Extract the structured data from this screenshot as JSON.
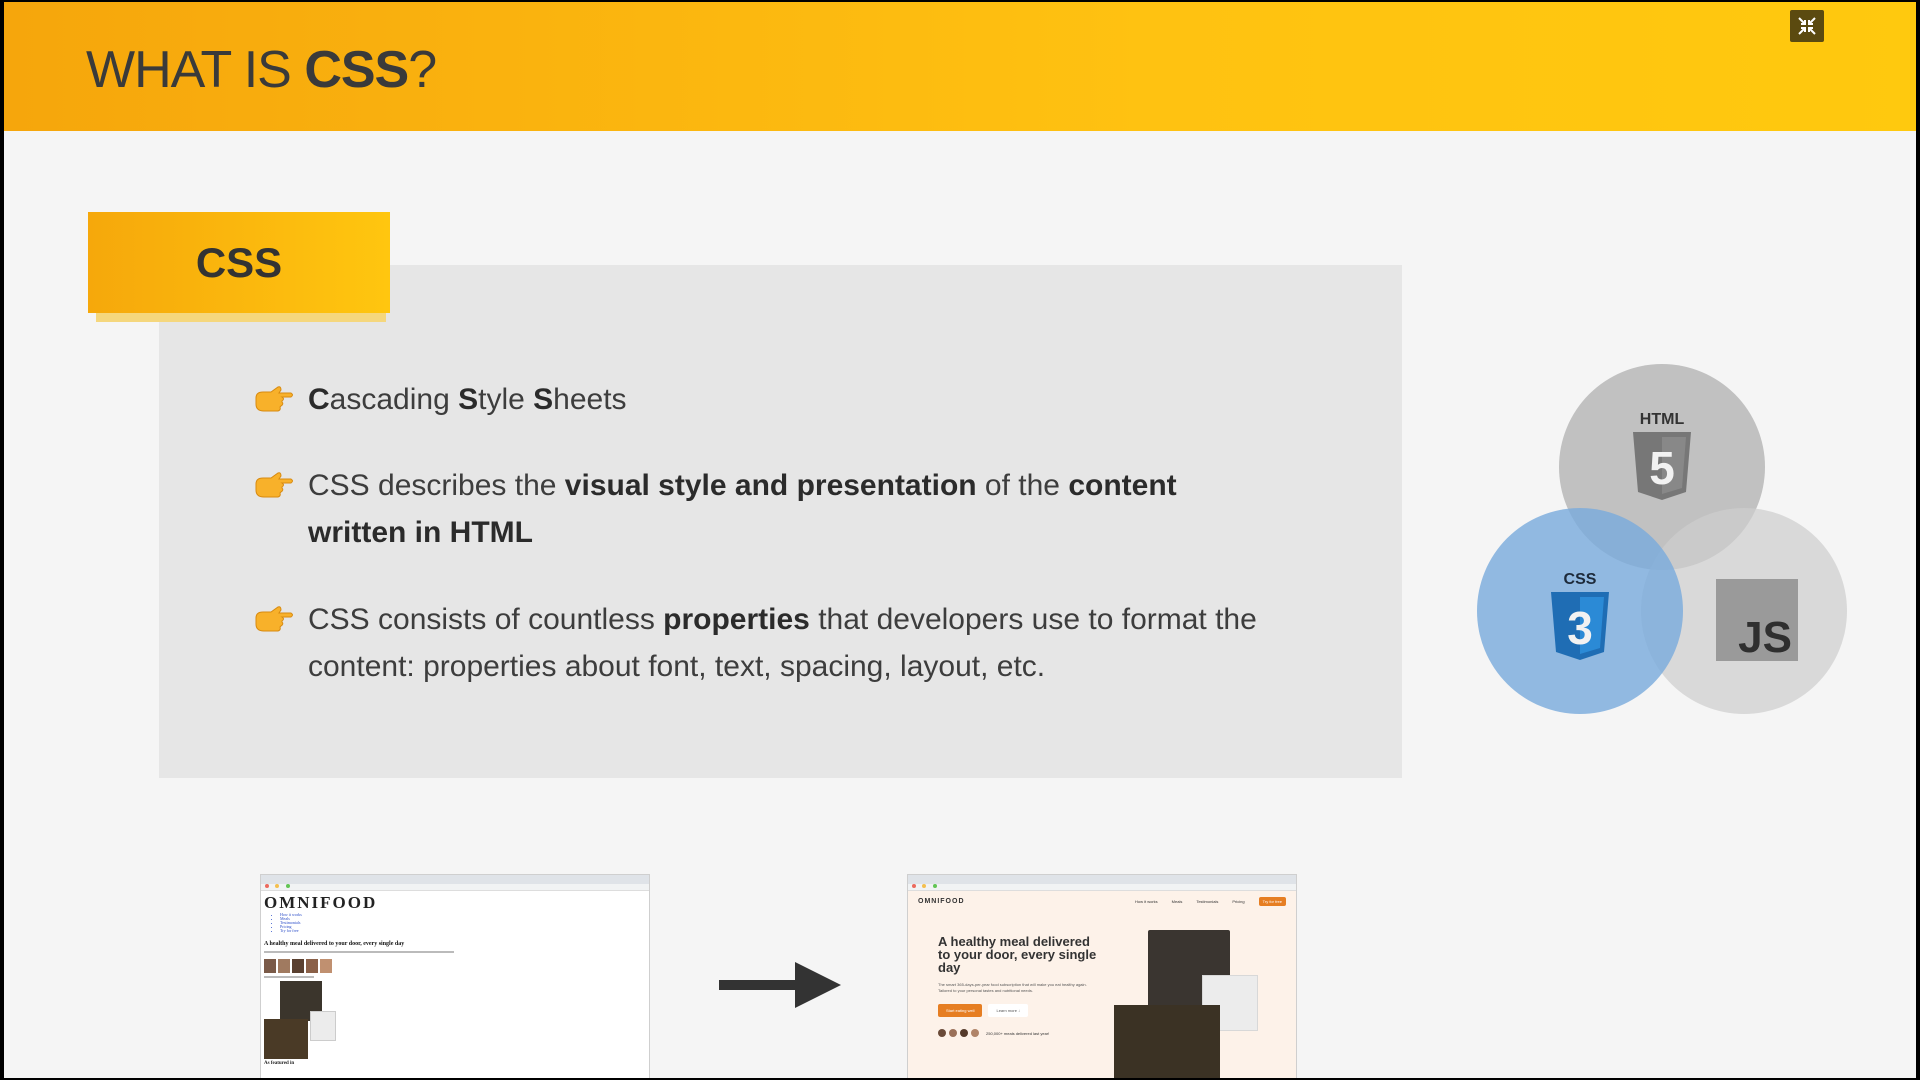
{
  "header": {
    "title_prefix": "WHAT IS ",
    "title_bold": "CSS",
    "title_suffix": "?"
  },
  "tag": {
    "label": "CSS"
  },
  "bullets": [
    {
      "parts": [
        {
          "t": "C",
          "b": true
        },
        {
          "t": "ascading ",
          "b": false
        },
        {
          "t": "S",
          "b": true
        },
        {
          "t": "tyle ",
          "b": false
        },
        {
          "t": "S",
          "b": true
        },
        {
          "t": "heets",
          "b": false
        }
      ]
    },
    {
      "parts": [
        {
          "t": "CSS describes the ",
          "b": false
        },
        {
          "t": "visual style and presentation",
          "b": true
        },
        {
          "t": " of the ",
          "b": false
        },
        {
          "t": "content written in HTML",
          "b": true
        }
      ]
    },
    {
      "parts": [
        {
          "t": "CSS consists of countless ",
          "b": false
        },
        {
          "t": "properties",
          "b": true
        },
        {
          "t": " that developers use to format the content: properties about font, text, spacing, layout, etc.",
          "b": false
        }
      ]
    }
  ],
  "venn": {
    "html_label": "HTML",
    "html_number": "5",
    "css_label": "CSS",
    "css_number": "3",
    "js_label": "JS"
  },
  "before": {
    "logo": "OMNIFOOD",
    "nav": [
      "How it works",
      "Meals",
      "Testimonials",
      "Pricing",
      "Try for free"
    ],
    "headline": "A healthy meal delivered to your door, every single day",
    "footer": "As featured in"
  },
  "after": {
    "logo": "OMNIFOOD",
    "nav": [
      "How it works",
      "Meals",
      "Testimonials",
      "Pricing",
      "Try for free"
    ],
    "headline": "A healthy meal delivered to your door, every single day",
    "body": "The smart 365-days-per-year food subscription that will make you eat healthy again. Tailored to your personal tastes and nutritional needs.",
    "cta_primary": "Start eating well",
    "cta_secondary": "Learn more ↓",
    "stat": "250,000+ meals delivered last year!"
  },
  "colors": {
    "accent": "#ffc20e",
    "css_blue": "#7fb0dc",
    "brand_orange": "#e67e22"
  }
}
